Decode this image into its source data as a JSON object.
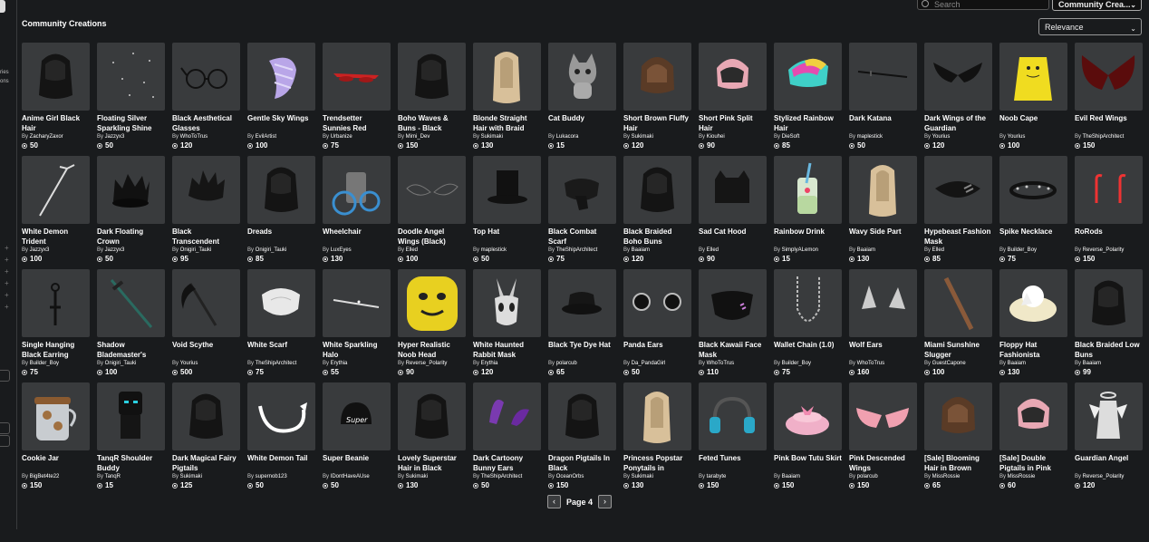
{
  "header": {
    "title": "Community Creations",
    "search_placeholder": "Search",
    "category": "Community Crea...",
    "sort": "Relevance"
  },
  "sidebar": {
    "text_lines": [
      "ries",
      "ons"
    ]
  },
  "pagination": {
    "label": "Page 4",
    "prev": "‹",
    "next": "›"
  },
  "colors": {
    "background": "#191b1d",
    "card": "#393b3d",
    "text": "#ffffff"
  },
  "items": [
    {
      "name": "Anime Girl Black Hair",
      "creator": "ZacharyZaxor",
      "price": "50",
      "icon": "black-hair"
    },
    {
      "name": "Floating Silver Sparkling Shine",
      "creator": "Jazzyx3",
      "price": "50",
      "icon": "sparkles"
    },
    {
      "name": "Black Aesthetical Glasses",
      "creator": "WhoToTrus",
      "price": "120",
      "icon": "glasses"
    },
    {
      "name": "Gentle Sky Wings",
      "creator": "EvilArtist",
      "price": "100",
      "icon": "wings"
    },
    {
      "name": "Trendsetter Sunnies Red",
      "creator": "Urbanize",
      "price": "75",
      "icon": "sunglasses"
    },
    {
      "name": "Boho Waves & Buns - Black",
      "creator": "Mimi_Dev",
      "price": "150",
      "icon": "black-hair"
    },
    {
      "name": "Blonde Straight Hair with Braid",
      "creator": "Sukimaki",
      "price": "130",
      "icon": "blonde-hair"
    },
    {
      "name": "Cat Buddy",
      "creator": "Lukacora",
      "price": "15",
      "icon": "cat"
    },
    {
      "name": "Short Brown Fluffy Hair",
      "creator": "Sukimaki",
      "price": "120",
      "icon": "brown-hair"
    },
    {
      "name": "Short Pink Split Hair",
      "creator": "Kiouhei",
      "price": "90",
      "icon": "pink-hair"
    },
    {
      "name": "Stylized Rainbow Hair",
      "creator": "DieSoft",
      "price": "85",
      "icon": "rainbow-hair"
    },
    {
      "name": "Dark Katana",
      "creator": "maplestick",
      "price": "50",
      "icon": "katana"
    },
    {
      "name": "Dark Wings of the Guardian",
      "creator": "Yourius",
      "price": "120",
      "icon": "dark-wings"
    },
    {
      "name": "Noob Cape",
      "creator": "Yourius",
      "price": "100",
      "icon": "yellow-cape"
    },
    {
      "name": "Evil Red Wings",
      "creator": "TheShipArchitect",
      "price": "150",
      "icon": "red-wings"
    },
    {
      "name": "White Demon Trident",
      "creator": "Jazzyx3",
      "price": "100",
      "icon": "trident"
    },
    {
      "name": "Dark Floating Crown",
      "creator": "Jazzyx3",
      "price": "50",
      "icon": "crown"
    },
    {
      "name": "Black Transcendent",
      "creator": "Onigiri_Tauki",
      "price": "95",
      "icon": "spiky-hair"
    },
    {
      "name": "Dreads",
      "creator": "Onigiri_Tauki",
      "price": "85",
      "icon": "black-hair"
    },
    {
      "name": "Wheelchair",
      "creator": "LuxEyes",
      "price": "130",
      "icon": "wheelchair"
    },
    {
      "name": "Doodle Angel Wings (Black)",
      "creator": "Elled",
      "price": "100",
      "icon": "outline-wings"
    },
    {
      "name": "Top Hat",
      "creator": "maplestick",
      "price": "50",
      "icon": "top-hat"
    },
    {
      "name": "Black Combat Scarf",
      "creator": "TheShipArchitect",
      "price": "75",
      "icon": "scarf"
    },
    {
      "name": "Black Braided Boho Buns",
      "creator": "Baaiam",
      "price": "120",
      "icon": "black-hair"
    },
    {
      "name": "Sad Cat Hood",
      "creator": "Elled",
      "price": "90",
      "icon": "cat-hood"
    },
    {
      "name": "Rainbow Drink",
      "creator": "SimplyALemon",
      "price": "15",
      "icon": "drink"
    },
    {
      "name": "Wavy Side Part",
      "creator": "Baaiam",
      "price": "130",
      "icon": "blonde-hair"
    },
    {
      "name": "Hypebeast Fashion Mask",
      "creator": "Elled",
      "price": "85",
      "icon": "mask"
    },
    {
      "name": "Spike Necklace",
      "creator": "Builder_Boy",
      "price": "75",
      "icon": "spike-necklace"
    },
    {
      "name": "RoRods",
      "creator": "Reverse_Polarity",
      "price": "150",
      "icon": "candy-canes"
    },
    {
      "name": "Single Hanging Black Earring",
      "creator": "Builder_Boy",
      "price": "75",
      "icon": "earring"
    },
    {
      "name": "Shadow Blademaster's",
      "creator": "Onigiri_Tauki",
      "price": "100",
      "icon": "sword"
    },
    {
      "name": "Void Scythe",
      "creator": "Yourius",
      "price": "500",
      "icon": "scythe"
    },
    {
      "name": "White Scarf",
      "creator": "TheShipArchitect",
      "price": "75",
      "icon": "white-scarf"
    },
    {
      "name": "White Sparkling Halo",
      "creator": "Erythia",
      "price": "55",
      "icon": "halo"
    },
    {
      "name": "Hyper Realistic Noob Head",
      "creator": "Reverse_Polarity",
      "price": "90",
      "icon": "noob-head"
    },
    {
      "name": "White Haunted Rabbit Mask",
      "creator": "Erythia",
      "price": "120",
      "icon": "rabbit-mask"
    },
    {
      "name": "Black Tye Dye Hat",
      "creator": "polarcub",
      "price": "65",
      "icon": "bucket-hat"
    },
    {
      "name": "Panda Ears",
      "creator": "Da_PandaGirl",
      "price": "50",
      "icon": "panda-ears"
    },
    {
      "name": "Black Kawaii Face Mask",
      "creator": "WhoToTrus",
      "price": "110",
      "icon": "face-mask"
    },
    {
      "name": "Wallet Chain (1.0)",
      "creator": "Builder_Boy",
      "price": "75",
      "icon": "chain"
    },
    {
      "name": "Wolf Ears",
      "creator": "WhoToTrus",
      "price": "160",
      "icon": "wolf-ears"
    },
    {
      "name": "Miami Sunshine Slugger",
      "creator": "GuestCapone",
      "price": "100",
      "icon": "bat"
    },
    {
      "name": "Floppy Hat Fashionista",
      "creator": "Baaiam",
      "price": "130",
      "icon": "floppy-hat"
    },
    {
      "name": "Black Braided Low Buns",
      "creator": "Baaiam",
      "price": "99",
      "icon": "black-hair"
    },
    {
      "name": "Cookie Jar",
      "creator": "BigBet4te22",
      "price": "150",
      "icon": "cookie-jar"
    },
    {
      "name": "TanqR Shoulder Buddy",
      "creator": "TanqR",
      "price": "15",
      "icon": "shoulder-buddy"
    },
    {
      "name": "Dark Magical Fairy Pigtails",
      "creator": "Sukimaki",
      "price": "125",
      "icon": "black-hair"
    },
    {
      "name": "White Demon Tail",
      "creator": "supernob123",
      "price": "50",
      "icon": "tail"
    },
    {
      "name": "Super Beanie",
      "creator": "IDontHaveAUse",
      "price": "50",
      "icon": "beanie"
    },
    {
      "name": "Lovely Superstar Hair in Black",
      "creator": "Sukimaki",
      "price": "130",
      "icon": "black-hair"
    },
    {
      "name": "Dark Cartoony Bunny Ears",
      "creator": "TheShipArchitect",
      "price": "50",
      "icon": "bunny-ears"
    },
    {
      "name": "Dragon Pigtails In Black",
      "creator": "OceanOrbs",
      "price": "150",
      "icon": "black-hair"
    },
    {
      "name": "Princess Popstar Ponytails in",
      "creator": "Sukimaki",
      "price": "130",
      "icon": "blonde-hair"
    },
    {
      "name": "Feted Tunes",
      "creator": "tarabyte",
      "price": "150",
      "icon": "headphones"
    },
    {
      "name": "Pink Bow Tutu Skirt",
      "creator": "Baaiam",
      "price": "150",
      "icon": "tutu"
    },
    {
      "name": "Pink Descended Wings",
      "creator": "polarcub",
      "price": "150",
      "icon": "pink-wings"
    },
    {
      "name": "[Sale] Blooming Hair in Brown",
      "creator": "MissRossie",
      "price": "65",
      "icon": "brown-hair"
    },
    {
      "name": "[Sale] Double Pigtails in Pink",
      "creator": "MissRossie",
      "price": "60",
      "icon": "pink-hair"
    },
    {
      "name": "Guardian Angel",
      "creator": "Reverse_Polarity",
      "price": "120",
      "icon": "angel"
    }
  ]
}
